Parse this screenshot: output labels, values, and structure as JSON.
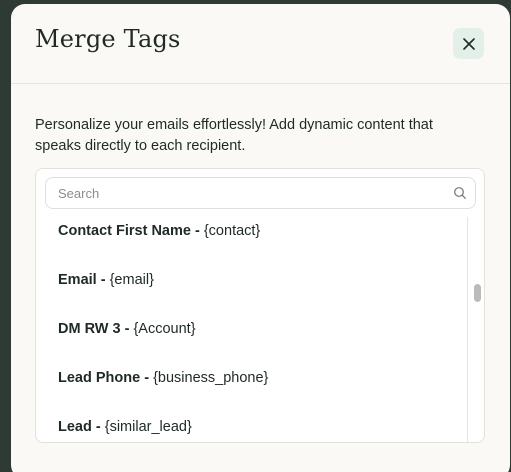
{
  "modal": {
    "title": "Merge Tags",
    "close_icon": "close-icon",
    "description": "Personalize your emails effortlessly! Add dynamic content that speaks directly to each recipient."
  },
  "search": {
    "placeholder": "Search",
    "value": "",
    "icon": "search-icon"
  },
  "merge_tags": [
    {
      "name": "Contact First Name",
      "separator": " - ",
      "tag": "{contact}"
    },
    {
      "name": "Email",
      "separator": " - ",
      "tag": "{email}"
    },
    {
      "name": "DM RW 3",
      "separator": " - ",
      "tag": "{Account}"
    },
    {
      "name": "Lead Phone",
      "separator": " - ",
      "tag": "{business_phone}"
    },
    {
      "name": "Lead",
      "separator": " - ",
      "tag": "{similar_lead}"
    }
  ],
  "colors": {
    "backdrop": "#2f3a35",
    "modal_background": "#faf9f5",
    "close_button_background": "#e3efe9",
    "text": "#1f2a25"
  }
}
